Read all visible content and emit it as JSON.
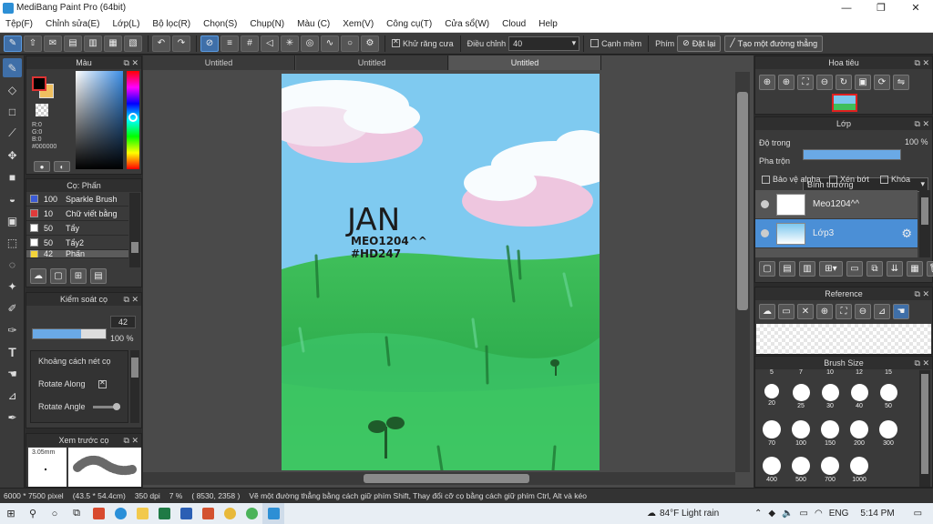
{
  "window": {
    "title": "MediBang Paint Pro (64bit)"
  },
  "menu": [
    "Tệp(F)",
    "Chỉnh sửa(E)",
    "Lớp(L)",
    "Bộ lọc(R)",
    "Chọn(S)",
    "Chụp(N)",
    "Màu (C)",
    "Xem(V)",
    "Công cụ(T)",
    "Cửa sổ(W)",
    "Cloud",
    "Help"
  ],
  "toolbar": {
    "antialias_label": "Khử răng cưa",
    "adjust_label": "Điều chỉnh",
    "adjust_value": "40",
    "smooth_label": "Cạnh mềm",
    "key_label": "Phím",
    "reset_label": "Đặt lại",
    "line_label": "Tạo một đường thẳng"
  },
  "color_panel": {
    "title": "Màu",
    "r": "R:0",
    "g": "G:0",
    "b": "B:0",
    "hex": "#000000",
    "fg": "#000000",
    "bg": "#f0c060"
  },
  "brush_panel": {
    "title": "Cọ: Phấn",
    "items": [
      {
        "size": "100",
        "name": "Sparkle Brush",
        "color": "#3b5bd6"
      },
      {
        "size": "10",
        "name": "Chữ viết bằng",
        "color": "#e03a3a"
      },
      {
        "size": "50",
        "name": "Tẩy",
        "color": "#ffffff"
      },
      {
        "size": "50",
        "name": "Tẩy2",
        "color": "#ffffff"
      },
      {
        "size": "42",
        "name": "Phấn",
        "color": "#f3d33a"
      }
    ]
  },
  "control_panel": {
    "title": "Kiểm soát cọ",
    "size_value": "42",
    "opacity_value": "100 %",
    "spacing_label": "Khoảng cách nét cọ",
    "rotate_along_label": "Rotate Along",
    "rotate_angle_label": "Rotate Angle"
  },
  "preview_panel": {
    "title": "Xem trước cọ",
    "size": "3.05mm"
  },
  "tabs": [
    "Untitled",
    "Untitled",
    "Untitled"
  ],
  "artwork": {
    "signature_big": "JAN",
    "signature_line1": "MEO1204^^",
    "signature_line2": "#HD247"
  },
  "navigator": {
    "title": "Hoa tiêu"
  },
  "layer_panel": {
    "title": "Lớp",
    "opacity_label": "Độ trong",
    "opacity_value": "100 %",
    "blend_label": "Pha trộn",
    "blend_value": "Bình thường",
    "protect_alpha": "Bảo vệ alpha",
    "clip": "Xén bớt",
    "lock": "Khóa",
    "layers": [
      {
        "name": "Meo1204^^",
        "selected": false
      },
      {
        "name": "Lớp3",
        "selected": true
      }
    ]
  },
  "ref_panel": {
    "title": "Reference"
  },
  "size_panel": {
    "title": "Brush Size",
    "row0": [
      "5",
      "7",
      "10",
      "12",
      "15"
    ],
    "rows": [
      [
        "20",
        "25",
        "30",
        "40",
        "50"
      ],
      [
        "70",
        "100",
        "150",
        "200",
        "300"
      ],
      [
        "400",
        "500",
        "700",
        "1000"
      ]
    ]
  },
  "status": {
    "dims": "6000 * 7500 pixel",
    "cm": "(43.5 * 54.4cm)",
    "dpi": "350 dpi",
    "zoom": "7 %",
    "coords": "( 8530, 2358 )",
    "hint": "Vẽ một đường thẳng bằng cách giữ phím Shift, Thay đổi cỡ cọ bằng cách giữ phím Ctrl, Alt và kéo"
  },
  "taskbar": {
    "weather": "84°F  Light rain",
    "lang": "ENG",
    "time": "5:14 PM"
  }
}
